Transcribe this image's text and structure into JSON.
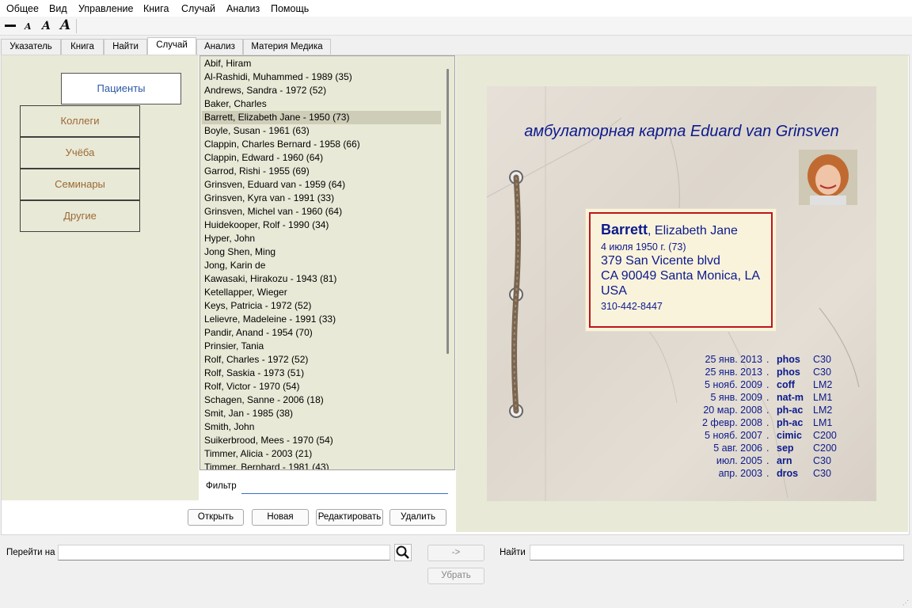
{
  "menu": [
    "Общее",
    "Вид",
    "Управление",
    "Книга",
    "Случай",
    "Анализ",
    "Помощь"
  ],
  "toolbar": {
    "labels": [
      "A",
      "A",
      "A"
    ]
  },
  "tabs": [
    "Указатель",
    "Книга",
    "Найти",
    "Случай",
    "Анализ",
    "Материя Медика"
  ],
  "active_tab": "Случай",
  "side_tabs": [
    "Пациенты",
    "Коллеги",
    "Учёба",
    "Семинары",
    "Другие"
  ],
  "patients": [
    "Abif, Hiram",
    "Al-Rashidi, Muhammed - 1989 (35)",
    "Andrews, Sandra - 1972 (52)",
    "Baker, Charles",
    "Barrett, Elizabeth Jane - 1950 (73)",
    "Boyle, Susan - 1961 (63)",
    "Clappin, Charles Bernard - 1958 (66)",
    "Clappin, Edward - 1960 (64)",
    "Garrod, Rishi - 1955 (69)",
    "Grinsven, Eduard van - 1959 (64)",
    "Grinsven, Kyra van - 1991 (33)",
    "Grinsven, Michel van - 1960 (64)",
    "Huidekooper, Rolf - 1990 (34)",
    "Hyper, John",
    "Jong Shen, Ming",
    "Jong, Karin de",
    "Kawasaki, Hirakozu - 1943 (81)",
    "Ketellapper, Wieger",
    "Keys, Patricia - 1972 (52)",
    "Lelievre, Madeleine - 1991 (33)",
    "Pandir, Anand - 1954 (70)",
    "Prinsier, Tania",
    "Rolf, Charles - 1972 (52)",
    "Rolf, Saskia - 1973 (51)",
    "Rolf, Victor - 1970 (54)",
    "Schagen, Sanne - 2006 (18)",
    "Smit, Jan - 1985 (38)",
    "Smith, John",
    "Suikerbrood, Mees - 1970 (54)",
    "Timmer, Alicia - 2003 (21)",
    "Timmer, Bernhard - 1981 (43)"
  ],
  "selected_patient": "Barrett, Elizabeth Jane - 1950 (73)",
  "filter": {
    "label": "Фильтр",
    "value": ""
  },
  "buttons": {
    "open": "Открыть",
    "new": "Новая",
    "edit": "Редактировать",
    "delete": "Удалить"
  },
  "card": {
    "title": "амбулаторная карта Eduard van Grinsven",
    "surname": "Barrett",
    "given": ", Elizabeth Jane",
    "birth": "4 июля 1950 г. (73)",
    "street": "379 San Vicente blvd",
    "city": "CA 90049  Santa Monica, LA",
    "country": "USA",
    "phone": "310-442-8447",
    "history": [
      {
        "date": "25 янв. 2013",
        "remedy": "phos",
        "potency": "C30"
      },
      {
        "date": "25 янв. 2013",
        "remedy": "phos",
        "potency": "C30"
      },
      {
        "date": "5 нояб. 2009",
        "remedy": "coff",
        "potency": "LM2"
      },
      {
        "date": "5 янв. 2009",
        "remedy": "nat-m",
        "potency": "LM1"
      },
      {
        "date": "20 мар. 2008",
        "remedy": "ph-ac",
        "potency": "LM2"
      },
      {
        "date": "2 февр. 2008",
        "remedy": "ph-ac",
        "potency": "LM1"
      },
      {
        "date": "5 нояб. 2007",
        "remedy": "cimic",
        "potency": "C200"
      },
      {
        "date": "5 авг. 2006",
        "remedy": "sep",
        "potency": "C200"
      },
      {
        "date": "июл. 2005",
        "remedy": "arn",
        "potency": "C30"
      },
      {
        "date": "апр. 2003",
        "remedy": "dros",
        "potency": "C30"
      }
    ],
    "history_sep": "."
  },
  "bottom": {
    "goto_label": "Перейти на",
    "goto_value": "",
    "arrow_button": "->",
    "find_label": "Найти",
    "find_value": "",
    "remove_button": "Убрать"
  },
  "colors": {
    "accent": "#2b58a6",
    "tab_text": "#9a6a35",
    "card_ink": "#0c1a8c",
    "frame_red": "#c0141b",
    "panel_bg": "#e9e9d7"
  },
  "icons": [
    "search-icon",
    "line-width-icon",
    "font-smaller-icon",
    "font-normal-icon",
    "font-larger-icon"
  ]
}
